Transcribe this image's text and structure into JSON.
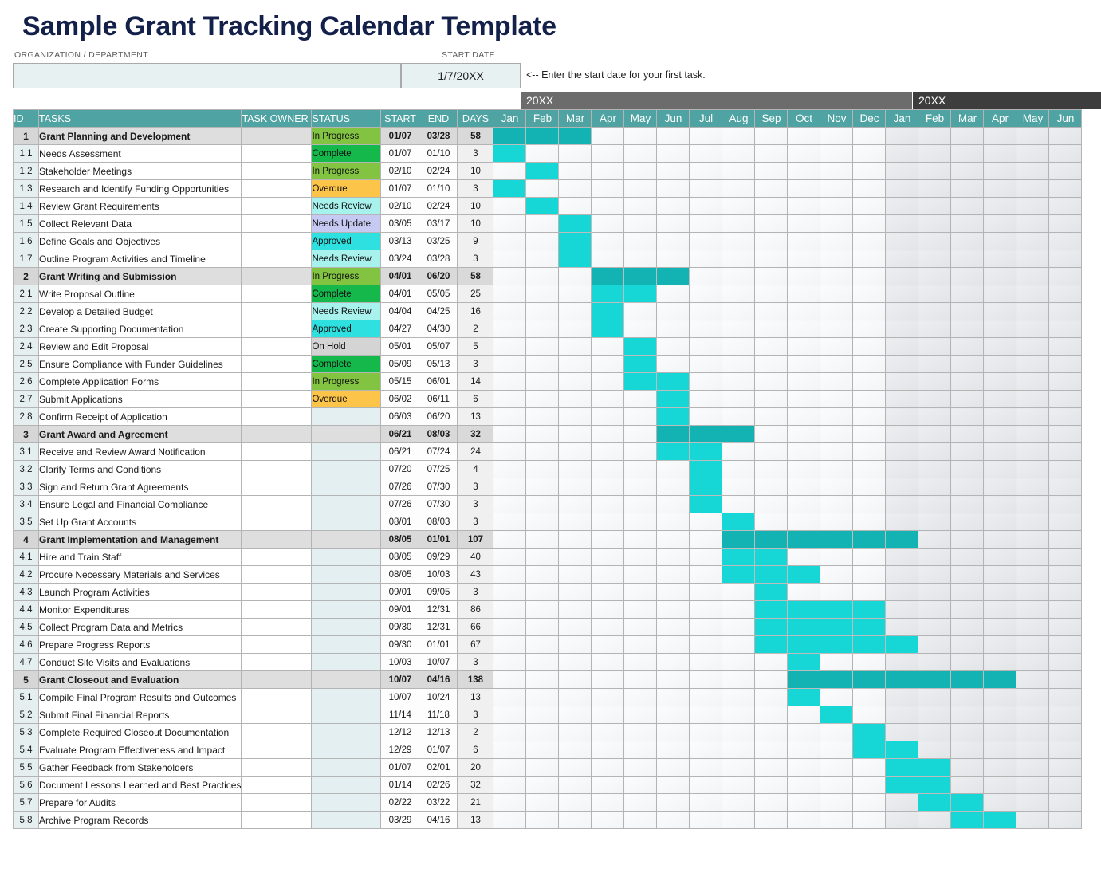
{
  "page": {
    "title": "Sample Grant Tracking Calendar Template"
  },
  "meta": {
    "org_label": "ORGANIZATION / DEPARTMENT",
    "org_value": "",
    "start_label": "START DATE",
    "start_value": "1/7/20XX",
    "note": "<-- Enter the start date for your first task."
  },
  "years": [
    {
      "label": "20XX",
      "span": 12
    },
    {
      "label": "20XX",
      "span": 6
    }
  ],
  "columns": {
    "id": "ID",
    "tasks": "TASKS",
    "owner": "TASK OWNER",
    "status": "STATUS",
    "start": "START",
    "end": "END",
    "days": "DAYS"
  },
  "months": [
    "Jan",
    "Feb",
    "Mar",
    "Apr",
    "May",
    "Jun",
    "Jul",
    "Aug",
    "Sep",
    "Oct",
    "Nov",
    "Dec",
    "Jan",
    "Feb",
    "Mar",
    "Apr",
    "May",
    "Jun"
  ],
  "status_colors": {
    "In Progress": "#82c341",
    "Complete": "#14b84b",
    "Overdue": "#fcc54a",
    "Needs Review": "#a8f2ee",
    "Needs Update": "#c6c9f2",
    "Approved": "#2ee0e0",
    "On Hold": "#d4d4d4"
  },
  "theme": {
    "header_teal": "#4fa3a3",
    "bar_task": "#16d6d6",
    "bar_section": "#14b3b3",
    "year1_band": "#6c6c6c",
    "year2_band": "#3d3d3d",
    "title_navy": "#13204a"
  },
  "rows": [
    {
      "id": "1",
      "task": "Grant Planning and Development",
      "owner": "",
      "status": "In Progress",
      "start": "01/07",
      "end": "03/28",
      "days": "58",
      "section": true,
      "bar_start": 0,
      "bar_len": 3
    },
    {
      "id": "1.1",
      "task": "Needs Assessment",
      "owner": "",
      "status": "Complete",
      "start": "01/07",
      "end": "01/10",
      "days": "3",
      "section": false,
      "bar_start": 0,
      "bar_len": 1
    },
    {
      "id": "1.2",
      "task": "Stakeholder Meetings",
      "owner": "",
      "status": "In Progress",
      "start": "02/10",
      "end": "02/24",
      "days": "10",
      "section": false,
      "bar_start": 1,
      "bar_len": 1
    },
    {
      "id": "1.3",
      "task": "Research and Identify Funding Opportunities",
      "owner": "",
      "status": "Overdue",
      "start": "01/07",
      "end": "01/10",
      "days": "3",
      "section": false,
      "bar_start": 0,
      "bar_len": 1
    },
    {
      "id": "1.4",
      "task": "Review Grant Requirements",
      "owner": "",
      "status": "Needs Review",
      "start": "02/10",
      "end": "02/24",
      "days": "10",
      "section": false,
      "bar_start": 1,
      "bar_len": 1
    },
    {
      "id": "1.5",
      "task": "Collect Relevant Data",
      "owner": "",
      "status": "Needs Update",
      "start": "03/05",
      "end": "03/17",
      "days": "10",
      "section": false,
      "bar_start": 2,
      "bar_len": 1
    },
    {
      "id": "1.6",
      "task": "Define Goals and Objectives",
      "owner": "",
      "status": "Approved",
      "start": "03/13",
      "end": "03/25",
      "days": "9",
      "section": false,
      "bar_start": 2,
      "bar_len": 1
    },
    {
      "id": "1.7",
      "task": "Outline Program Activities and Timeline",
      "owner": "",
      "status": "Needs Review",
      "start": "03/24",
      "end": "03/28",
      "days": "3",
      "section": false,
      "bar_start": 2,
      "bar_len": 1
    },
    {
      "id": "2",
      "task": "Grant Writing and Submission",
      "owner": "",
      "status": "In Progress",
      "start": "04/01",
      "end": "06/20",
      "days": "58",
      "section": true,
      "bar_start": 3,
      "bar_len": 3
    },
    {
      "id": "2.1",
      "task": "Write Proposal Outline",
      "owner": "",
      "status": "Complete",
      "start": "04/01",
      "end": "05/05",
      "days": "25",
      "section": false,
      "bar_start": 3,
      "bar_len": 2
    },
    {
      "id": "2.2",
      "task": "Develop a Detailed Budget",
      "owner": "",
      "status": "Needs Review",
      "start": "04/04",
      "end": "04/25",
      "days": "16",
      "section": false,
      "bar_start": 3,
      "bar_len": 1
    },
    {
      "id": "2.3",
      "task": "Create Supporting Documentation",
      "owner": "",
      "status": "Approved",
      "start": "04/27",
      "end": "04/30",
      "days": "2",
      "section": false,
      "bar_start": 3,
      "bar_len": 1
    },
    {
      "id": "2.4",
      "task": "Review and Edit Proposal",
      "owner": "",
      "status": "On Hold",
      "start": "05/01",
      "end": "05/07",
      "days": "5",
      "section": false,
      "bar_start": 4,
      "bar_len": 1
    },
    {
      "id": "2.5",
      "task": "Ensure Compliance with Funder Guidelines",
      "owner": "",
      "status": "Complete",
      "start": "05/09",
      "end": "05/13",
      "days": "3",
      "section": false,
      "bar_start": 4,
      "bar_len": 1
    },
    {
      "id": "2.6",
      "task": "Complete Application Forms",
      "owner": "",
      "status": "In Progress",
      "start": "05/15",
      "end": "06/01",
      "days": "14",
      "section": false,
      "bar_start": 4,
      "bar_len": 2
    },
    {
      "id": "2.7",
      "task": "Submit Applications",
      "owner": "",
      "status": "Overdue",
      "start": "06/02",
      "end": "06/11",
      "days": "6",
      "section": false,
      "bar_start": 5,
      "bar_len": 1
    },
    {
      "id": "2.8",
      "task": "Confirm Receipt of Application",
      "owner": "",
      "status": "",
      "start": "06/03",
      "end": "06/20",
      "days": "13",
      "section": false,
      "bar_start": 5,
      "bar_len": 1
    },
    {
      "id": "3",
      "task": "Grant Award and Agreement",
      "owner": "",
      "status": "",
      "start": "06/21",
      "end": "08/03",
      "days": "32",
      "section": true,
      "bar_start": 5,
      "bar_len": 3
    },
    {
      "id": "3.1",
      "task": "Receive and Review Award Notification",
      "owner": "",
      "status": "",
      "start": "06/21",
      "end": "07/24",
      "days": "24",
      "section": false,
      "bar_start": 5,
      "bar_len": 2
    },
    {
      "id": "3.2",
      "task": "Clarify Terms and Conditions",
      "owner": "",
      "status": "",
      "start": "07/20",
      "end": "07/25",
      "days": "4",
      "section": false,
      "bar_start": 6,
      "bar_len": 1
    },
    {
      "id": "3.3",
      "task": "Sign and Return Grant Agreements",
      "owner": "",
      "status": "",
      "start": "07/26",
      "end": "07/30",
      "days": "3",
      "section": false,
      "bar_start": 6,
      "bar_len": 1
    },
    {
      "id": "3.4",
      "task": "Ensure Legal and Financial Compliance",
      "owner": "",
      "status": "",
      "start": "07/26",
      "end": "07/30",
      "days": "3",
      "section": false,
      "bar_start": 6,
      "bar_len": 1
    },
    {
      "id": "3.5",
      "task": "Set Up Grant Accounts",
      "owner": "",
      "status": "",
      "start": "08/01",
      "end": "08/03",
      "days": "3",
      "section": false,
      "bar_start": 7,
      "bar_len": 1
    },
    {
      "id": "4",
      "task": "Grant Implementation and Management",
      "owner": "",
      "status": "",
      "start": "08/05",
      "end": "01/01",
      "days": "107",
      "section": true,
      "bar_start": 7,
      "bar_len": 6
    },
    {
      "id": "4.1",
      "task": "Hire and Train Staff",
      "owner": "",
      "status": "",
      "start": "08/05",
      "end": "09/29",
      "days": "40",
      "section": false,
      "bar_start": 7,
      "bar_len": 2
    },
    {
      "id": "4.2",
      "task": "Procure Necessary Materials and Services",
      "owner": "",
      "status": "",
      "start": "08/05",
      "end": "10/03",
      "days": "43",
      "section": false,
      "bar_start": 7,
      "bar_len": 3
    },
    {
      "id": "4.3",
      "task": "Launch Program Activities",
      "owner": "",
      "status": "",
      "start": "09/01",
      "end": "09/05",
      "days": "3",
      "section": false,
      "bar_start": 8,
      "bar_len": 1
    },
    {
      "id": "4.4",
      "task": "Monitor Expenditures",
      "owner": "",
      "status": "",
      "start": "09/01",
      "end": "12/31",
      "days": "86",
      "section": false,
      "bar_start": 8,
      "bar_len": 4
    },
    {
      "id": "4.5",
      "task": "Collect Program Data and Metrics",
      "owner": "",
      "status": "",
      "start": "09/30",
      "end": "12/31",
      "days": "66",
      "section": false,
      "bar_start": 8,
      "bar_len": 4
    },
    {
      "id": "4.6",
      "task": "Prepare Progress Reports",
      "owner": "",
      "status": "",
      "start": "09/30",
      "end": "01/01",
      "days": "67",
      "section": false,
      "bar_start": 8,
      "bar_len": 5
    },
    {
      "id": "4.7",
      "task": "Conduct Site Visits and Evaluations",
      "owner": "",
      "status": "",
      "start": "10/03",
      "end": "10/07",
      "days": "3",
      "section": false,
      "bar_start": 9,
      "bar_len": 1
    },
    {
      "id": "5",
      "task": "Grant Closeout and Evaluation",
      "owner": "",
      "status": "",
      "start": "10/07",
      "end": "04/16",
      "days": "138",
      "section": true,
      "bar_start": 9,
      "bar_len": 7
    },
    {
      "id": "5.1",
      "task": "Compile Final Program Results and Outcomes",
      "owner": "",
      "status": "",
      "start": "10/07",
      "end": "10/24",
      "days": "13",
      "section": false,
      "bar_start": 9,
      "bar_len": 1
    },
    {
      "id": "5.2",
      "task": "Submit Final Financial Reports",
      "owner": "",
      "status": "",
      "start": "11/14",
      "end": "11/18",
      "days": "3",
      "section": false,
      "bar_start": 10,
      "bar_len": 1
    },
    {
      "id": "5.3",
      "task": "Complete Required Closeout Documentation",
      "owner": "",
      "status": "",
      "start": "12/12",
      "end": "12/13",
      "days": "2",
      "section": false,
      "bar_start": 11,
      "bar_len": 1
    },
    {
      "id": "5.4",
      "task": "Evaluate Program Effectiveness and Impact",
      "owner": "",
      "status": "",
      "start": "12/29",
      "end": "01/07",
      "days": "6",
      "section": false,
      "bar_start": 11,
      "bar_len": 2
    },
    {
      "id": "5.5",
      "task": "Gather Feedback from Stakeholders",
      "owner": "",
      "status": "",
      "start": "01/07",
      "end": "02/01",
      "days": "20",
      "section": false,
      "bar_start": 12,
      "bar_len": 2
    },
    {
      "id": "5.6",
      "task": "Document Lessons Learned and Best Practices",
      "owner": "",
      "status": "",
      "start": "01/14",
      "end": "02/26",
      "days": "32",
      "section": false,
      "bar_start": 12,
      "bar_len": 2
    },
    {
      "id": "5.7",
      "task": "Prepare for Audits",
      "owner": "",
      "status": "",
      "start": "02/22",
      "end": "03/22",
      "days": "21",
      "section": false,
      "bar_start": 13,
      "bar_len": 2
    },
    {
      "id": "5.8",
      "task": "Archive Program Records",
      "owner": "",
      "status": "",
      "start": "03/29",
      "end": "04/16",
      "days": "13",
      "section": false,
      "bar_start": 14,
      "bar_len": 2
    }
  ]
}
